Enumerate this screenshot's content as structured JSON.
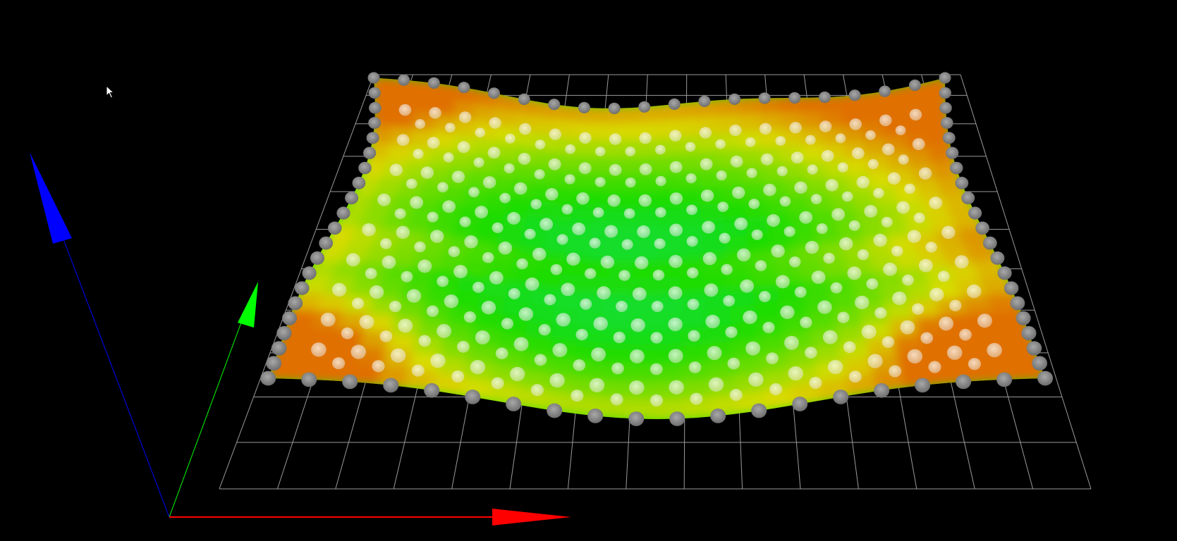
{
  "viewer": {
    "background": "#000000",
    "grid": {
      "cols": 15,
      "rows": 11,
      "color": "#9a9a9a"
    },
    "surface": {
      "probe_cols": 20,
      "probe_rows": 11,
      "colors": {
        "low": "#00e07a",
        "mid": "#1edc00",
        "high": "#d8dc00",
        "peak": "#e07000"
      }
    },
    "axes": {
      "x": {
        "color": "#ff0000"
      },
      "y": {
        "color": "#00ff00"
      },
      "z": {
        "color": "#0000ff"
      }
    }
  }
}
